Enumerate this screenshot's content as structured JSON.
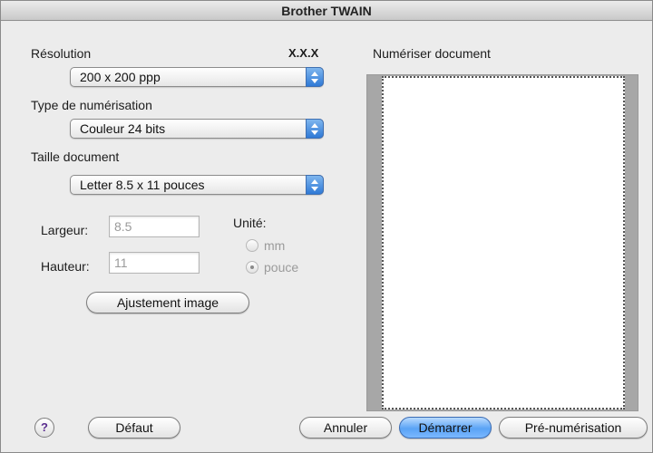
{
  "window": {
    "title": "Brother TWAIN"
  },
  "resolution": {
    "label": "Résolution",
    "version": "X.X.X",
    "value": "200 x 200 ppp"
  },
  "scan_type": {
    "label": "Type de numérisation",
    "value": "Couleur 24 bits"
  },
  "doc_size": {
    "label": "Taille document",
    "value": "Letter  8.5 x 11 pouces"
  },
  "width": {
    "label": "Largeur:",
    "value": "8.5"
  },
  "height": {
    "label": "Hauteur:",
    "value": "11"
  },
  "unit": {
    "label": "Unité:",
    "options": [
      {
        "label": "mm",
        "selected": false
      },
      {
        "label": "pouce",
        "selected": true
      }
    ]
  },
  "buttons": {
    "adjust": "Ajustement image",
    "help": "?",
    "default": "Défaut",
    "cancel": "Annuler",
    "start": "Démarrer",
    "prescan": "Pré-numérisation"
  },
  "preview": {
    "label": "Numériser document"
  }
}
